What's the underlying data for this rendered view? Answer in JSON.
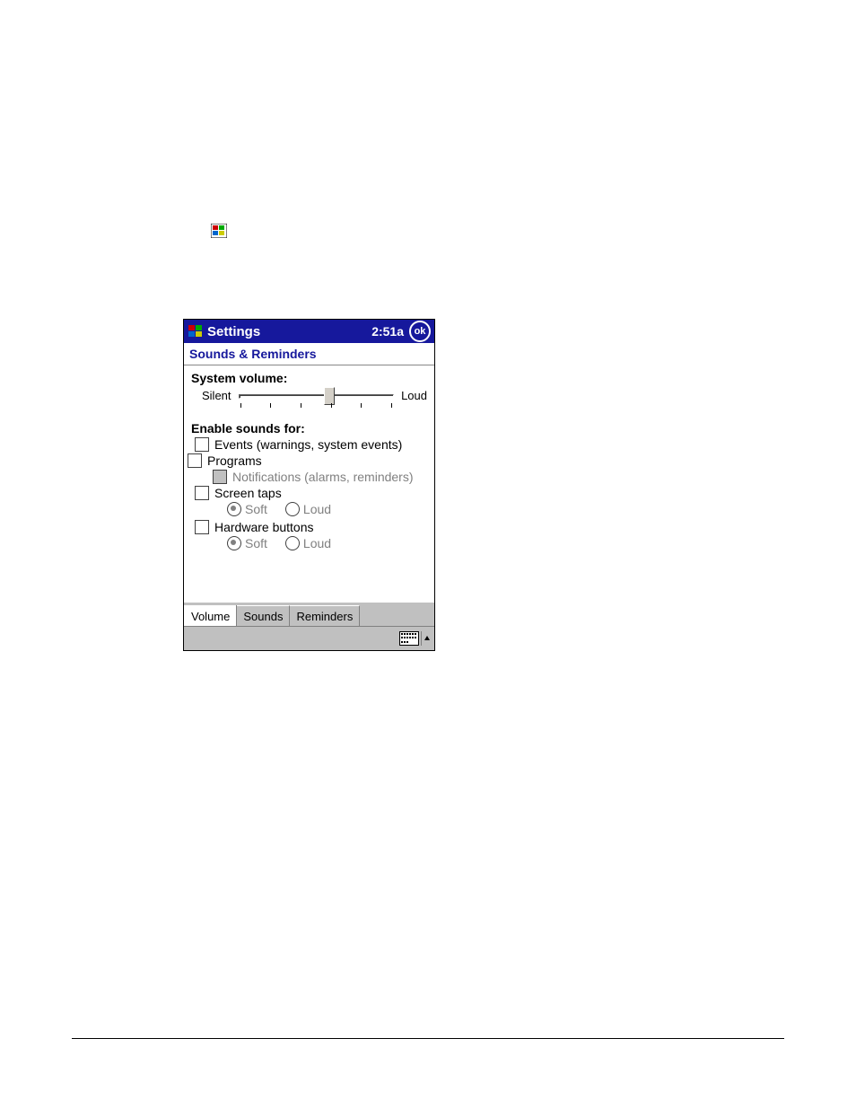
{
  "titlebar": {
    "title": "Settings",
    "clock": "2:51a",
    "ok_label": "ok"
  },
  "subheader": "Sounds & Reminders",
  "volume": {
    "heading": "System volume:",
    "min_label": "Silent",
    "max_label": "Loud"
  },
  "enable_heading": "Enable sounds for:",
  "options": {
    "events": "Events (warnings, system events)",
    "programs": "Programs",
    "notifications": "Notifications (alarms, reminders)",
    "screen_taps": "Screen taps",
    "hardware_buttons": "Hardware buttons",
    "soft": "Soft",
    "loud": "Loud"
  },
  "tabs": {
    "volume": "Volume",
    "sounds": "Sounds",
    "reminders": "Reminders"
  }
}
